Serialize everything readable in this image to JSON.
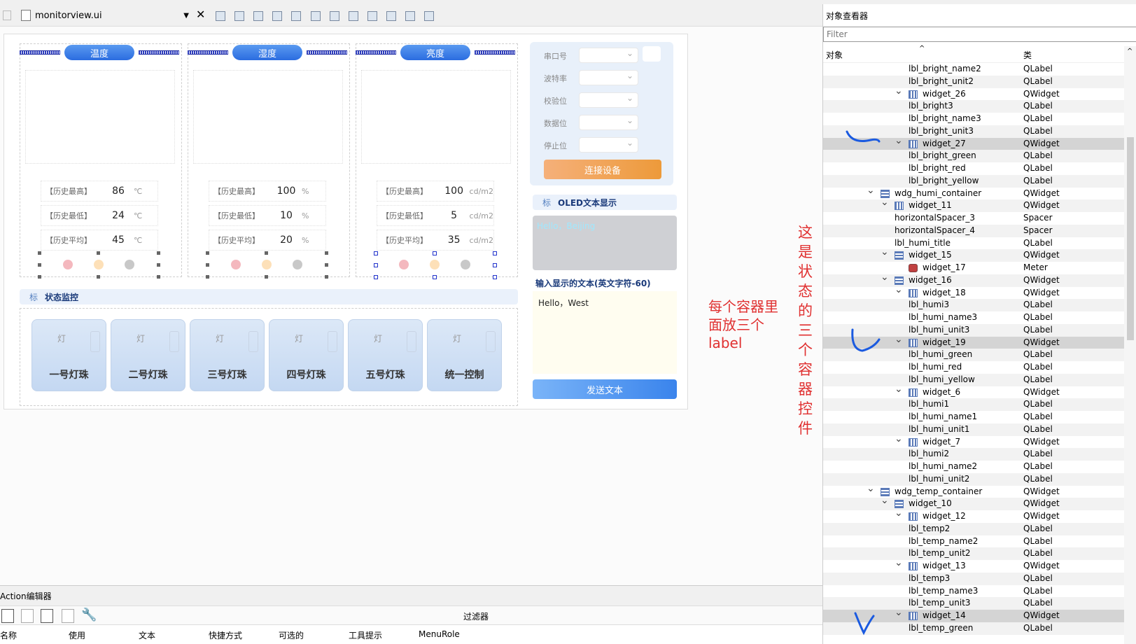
{
  "toolbar": {
    "file_name": "monitorview.ui"
  },
  "sensors": [
    {
      "title": "温度",
      "rows": [
        {
          "name": "【历史最高】",
          "value": "86",
          "unit": "℃"
        },
        {
          "name": "【历史最低】",
          "value": "24",
          "unit": "℃"
        },
        {
          "name": "【历史平均】",
          "value": "45",
          "unit": "℃"
        }
      ]
    },
    {
      "title": "湿度",
      "rows": [
        {
          "name": "【历史最高】",
          "value": "100",
          "unit": "%"
        },
        {
          "name": "【历史最低】",
          "value": "10",
          "unit": "%"
        },
        {
          "name": "【历史平均】",
          "value": "20",
          "unit": "%"
        }
      ]
    },
    {
      "title": "亮度",
      "rows": [
        {
          "name": "【历史最高】",
          "value": "100",
          "unit": "cd/m2"
        },
        {
          "name": "【历史最低】",
          "value": "5",
          "unit": "cd/m2"
        },
        {
          "name": "【历史平均】",
          "value": "35",
          "unit": "cd/m2"
        }
      ]
    }
  ],
  "dot_colors": [
    "#f4b8be",
    "#fde0b8",
    "#c8c8c8"
  ],
  "serial": {
    "labels": [
      "串口号",
      "波特率",
      "校验位",
      "数据位",
      "停止位"
    ],
    "connect_button": "连接设备"
  },
  "oled": {
    "section_icon": "标",
    "section_title": "OLED文本显示",
    "display_text": "Hello，Beijing",
    "input_label": "输入显示的文本(英文字符-60)",
    "input_value": "Hello，West",
    "send_button": "发送文本"
  },
  "status": {
    "section_icon": "标",
    "section_title": "状态监控",
    "lamp_label": "灯",
    "bulbs": [
      "一号灯珠",
      "二号灯珠",
      "三号灯珠",
      "四号灯珠",
      "五号灯珠",
      "统一控制"
    ]
  },
  "annotations": {
    "container_note": [
      "每个容器里",
      "面放三个",
      "label"
    ],
    "vertical_note": [
      "这",
      "是",
      "状",
      "态",
      "的",
      "三",
      "个",
      "容",
      "器",
      "控",
      "件"
    ]
  },
  "action_editor": {
    "title": "Action编辑器",
    "filter_label": "过滤器",
    "columns": [
      "名称",
      "使用",
      "文本",
      "快捷方式",
      "可选的",
      "工具提示",
      "MenuRole"
    ]
  },
  "inspector": {
    "title": "对象查看器",
    "filter_placeholder": "Filter",
    "col_object": "对象",
    "col_class": "类",
    "rows": [
      {
        "name": "lbl_bright_name2",
        "cls": "QLabel",
        "level": 4,
        "icon": "",
        "expand": false
      },
      {
        "name": "lbl_bright_unit2",
        "cls": "QLabel",
        "level": 4,
        "icon": "",
        "expand": false
      },
      {
        "name": "widget_26",
        "cls": "QWidget",
        "level": 3,
        "icon": "h",
        "expand": true
      },
      {
        "name": "lbl_bright3",
        "cls": "QLabel",
        "level": 4,
        "icon": "",
        "expand": false
      },
      {
        "name": "lbl_bright_name3",
        "cls": "QLabel",
        "level": 4,
        "icon": "",
        "expand": false
      },
      {
        "name": "lbl_bright_unit3",
        "cls": "QLabel",
        "level": 4,
        "icon": "",
        "expand": false
      },
      {
        "name": "widget_27",
        "cls": "QWidget",
        "level": 3,
        "icon": "h",
        "expand": true,
        "sel": true
      },
      {
        "name": "lbl_bright_green",
        "cls": "QLabel",
        "level": 4,
        "icon": "",
        "expand": false
      },
      {
        "name": "lbl_bright_red",
        "cls": "QLabel",
        "level": 4,
        "icon": "",
        "expand": false
      },
      {
        "name": "lbl_bright_yellow",
        "cls": "QLabel",
        "level": 4,
        "icon": "",
        "expand": false
      },
      {
        "name": "wdg_humi_container",
        "cls": "QWidget",
        "level": 1,
        "icon": "v",
        "expand": true
      },
      {
        "name": "widget_11",
        "cls": "QWidget",
        "level": 2,
        "icon": "h",
        "expand": true
      },
      {
        "name": "horizontalSpacer_3",
        "cls": "Spacer",
        "level": 3,
        "icon": "",
        "expand": false
      },
      {
        "name": "horizontalSpacer_4",
        "cls": "Spacer",
        "level": 3,
        "icon": "",
        "expand": false
      },
      {
        "name": "lbl_humi_title",
        "cls": "QLabel",
        "level": 3,
        "icon": "",
        "expand": false
      },
      {
        "name": "widget_15",
        "cls": "QWidget",
        "level": 2,
        "icon": "v",
        "expand": true
      },
      {
        "name": "widget_17",
        "cls": "Meter",
        "level": 3,
        "icon": "m",
        "expand": false
      },
      {
        "name": "widget_16",
        "cls": "QWidget",
        "level": 2,
        "icon": "v",
        "expand": true
      },
      {
        "name": "widget_18",
        "cls": "QWidget",
        "level": 3,
        "icon": "h",
        "expand": true
      },
      {
        "name": "lbl_humi3",
        "cls": "QLabel",
        "level": 4,
        "icon": "",
        "expand": false
      },
      {
        "name": "lbl_humi_name3",
        "cls": "QLabel",
        "level": 4,
        "icon": "",
        "expand": false
      },
      {
        "name": "lbl_humi_unit3",
        "cls": "QLabel",
        "level": 4,
        "icon": "",
        "expand": false
      },
      {
        "name": "widget_19",
        "cls": "QWidget",
        "level": 3,
        "icon": "h",
        "expand": true,
        "sel": true
      },
      {
        "name": "lbl_humi_green",
        "cls": "QLabel",
        "level": 4,
        "icon": "",
        "expand": false
      },
      {
        "name": "lbl_humi_red",
        "cls": "QLabel",
        "level": 4,
        "icon": "",
        "expand": false
      },
      {
        "name": "lbl_humi_yellow",
        "cls": "QLabel",
        "level": 4,
        "icon": "",
        "expand": false
      },
      {
        "name": "widget_6",
        "cls": "QWidget",
        "level": 3,
        "icon": "h",
        "expand": true
      },
      {
        "name": "lbl_humi1",
        "cls": "QLabel",
        "level": 4,
        "icon": "",
        "expand": false
      },
      {
        "name": "lbl_humi_name1",
        "cls": "QLabel",
        "level": 4,
        "icon": "",
        "expand": false
      },
      {
        "name": "lbl_humi_unit1",
        "cls": "QLabel",
        "level": 4,
        "icon": "",
        "expand": false
      },
      {
        "name": "widget_7",
        "cls": "QWidget",
        "level": 3,
        "icon": "h",
        "expand": true
      },
      {
        "name": "lbl_humi2",
        "cls": "QLabel",
        "level": 4,
        "icon": "",
        "expand": false
      },
      {
        "name": "lbl_humi_name2",
        "cls": "QLabel",
        "level": 4,
        "icon": "",
        "expand": false
      },
      {
        "name": "lbl_humi_unit2",
        "cls": "QLabel",
        "level": 4,
        "icon": "",
        "expand": false
      },
      {
        "name": "wdg_temp_container",
        "cls": "QWidget",
        "level": 1,
        "icon": "v",
        "expand": true
      },
      {
        "name": "widget_10",
        "cls": "QWidget",
        "level": 2,
        "icon": "v",
        "expand": true
      },
      {
        "name": "widget_12",
        "cls": "QWidget",
        "level": 3,
        "icon": "h",
        "expand": true
      },
      {
        "name": "lbl_temp2",
        "cls": "QLabel",
        "level": 4,
        "icon": "",
        "expand": false
      },
      {
        "name": "lbl_temp_name2",
        "cls": "QLabel",
        "level": 4,
        "icon": "",
        "expand": false
      },
      {
        "name": "lbl_temp_unit2",
        "cls": "QLabel",
        "level": 4,
        "icon": "",
        "expand": false
      },
      {
        "name": "widget_13",
        "cls": "QWidget",
        "level": 3,
        "icon": "h",
        "expand": true
      },
      {
        "name": "lbl_temp3",
        "cls": "QLabel",
        "level": 4,
        "icon": "",
        "expand": false
      },
      {
        "name": "lbl_temp_name3",
        "cls": "QLabel",
        "level": 4,
        "icon": "",
        "expand": false
      },
      {
        "name": "lbl_temp_unit3",
        "cls": "QLabel",
        "level": 4,
        "icon": "",
        "expand": false
      },
      {
        "name": "widget_14",
        "cls": "QWidget",
        "level": 3,
        "icon": "h",
        "expand": true,
        "sel": true
      },
      {
        "name": "lbl_temp_green",
        "cls": "QLabel",
        "level": 4,
        "icon": "",
        "expand": false
      }
    ]
  }
}
